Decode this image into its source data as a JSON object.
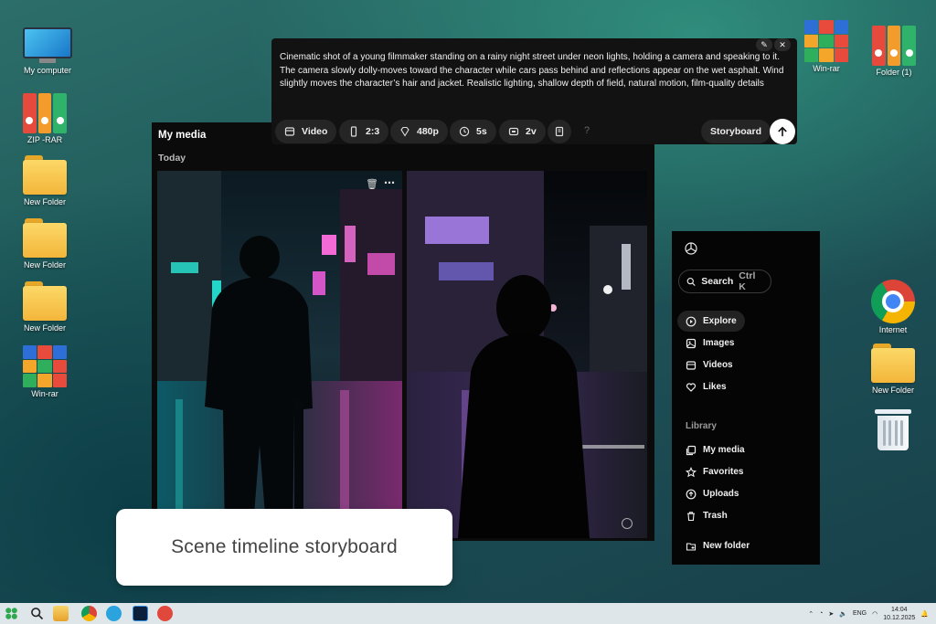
{
  "desktop": {
    "left_icons": [
      {
        "label": "My computer",
        "icon": "monitor-icon"
      },
      {
        "label": "ZIP -RAR",
        "icon": "archive-icon"
      },
      {
        "label": "New Folder",
        "icon": "folder-icon"
      },
      {
        "label": "New Folder",
        "icon": "folder-icon"
      },
      {
        "label": "New Folder",
        "icon": "folder-icon"
      },
      {
        "label": "Win-rar",
        "icon": "winrar-icon"
      }
    ],
    "top_right_icons": [
      {
        "label": "Win-rar",
        "icon": "winrar-icon"
      },
      {
        "label": "Folder (1)",
        "icon": "archive-icon"
      }
    ],
    "right_icons": [
      {
        "label": "Internet",
        "icon": "chrome-icon"
      },
      {
        "label": "New Folder",
        "icon": "folder-icon"
      },
      {
        "label": "",
        "icon": "recycle-bin-icon"
      }
    ]
  },
  "prompt": {
    "text": "Cinematic shot of a young filmmaker standing on a rainy night street under neon lights, holding a camera and speaking to it. The camera slowly dolly-moves toward the character while cars pass behind and reflections appear on the wet asphalt. Wind slightly moves the character’s hair and jacket. Realistic lighting, shallow depth of field, natural motion, film-quality details",
    "edit_icon": "pencil-icon",
    "close_icon": "close-icon",
    "options": {
      "mode": "Video",
      "aspect": "2:3",
      "resolution": "480p",
      "duration": "5s",
      "variants": "2v",
      "help": "?"
    },
    "storyboard_label": "Storyboard",
    "send_icon": "arrow-up-icon"
  },
  "media": {
    "title": "My media",
    "section": "Today"
  },
  "caption": "Scene timeline storyboard",
  "sidebar": {
    "search_label": "Search",
    "search_shortcut": "Ctrl K",
    "nav": [
      "Explore",
      "Images",
      "Videos",
      "Likes"
    ],
    "library_heading": "Library",
    "library": [
      "My media",
      "Favorites",
      "Uploads",
      "Trash"
    ],
    "new_folder": "New folder"
  },
  "taskbar": {
    "language": "ENG",
    "time": "14:04",
    "date": "10.12.2025"
  },
  "colors": {
    "panel_bg": "#121212",
    "accent_white": "#ffffff",
    "desktop_teal": "#1f5a5a"
  }
}
